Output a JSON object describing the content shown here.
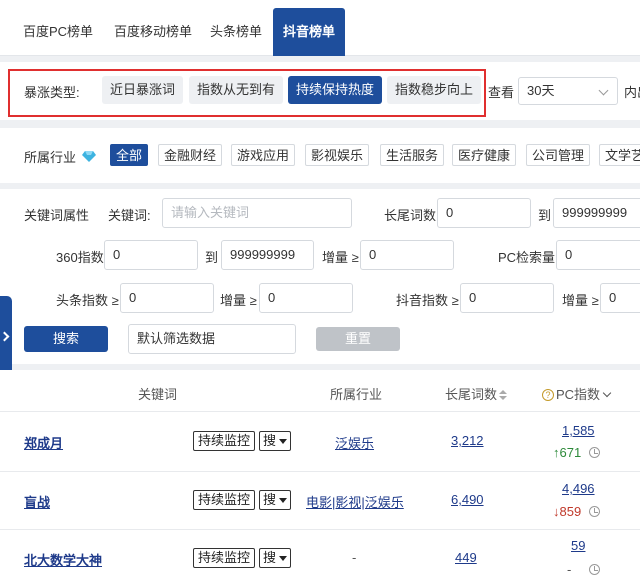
{
  "tabs": [
    "百度PC榜单",
    "百度移动榜单",
    "头条榜单",
    "抖音榜单"
  ],
  "surge": {
    "label": "暴涨类型:",
    "options": [
      "近日暴涨词",
      "指数从无到有",
      "持续保持热度",
      "指数稳步向上"
    ],
    "view_label": "查看",
    "range_value": "30天",
    "trailing": "内出"
  },
  "industry": {
    "label": "所属行业",
    "items": [
      "全部",
      "金融财经",
      "游戏应用",
      "影视娱乐",
      "生活服务",
      "医疗健康",
      "公司管理",
      "文学艺"
    ]
  },
  "filters": {
    "attr_label": "关键词属性",
    "keyword_label": "关键词:",
    "keyword_placeholder": "请输入关键词",
    "longtail_label": "长尾词数",
    "longtail_min": "0",
    "to": "到",
    "longtail_max": "999999999",
    "idx360_label": "360指数",
    "idx360_min": "0",
    "idx360_max": "999999999",
    "inc_label": "增量 ≥",
    "idx360_inc": "0",
    "pc_search_label": "PC检索量",
    "pc_search_val": "0",
    "toutiao_label": "头条指数 ≥",
    "toutiao_val": "0",
    "toutiao_inc": "0",
    "douyin_label": "抖音指数 ≥",
    "douyin_val": "0",
    "douyin_inc": "0",
    "search_btn": "搜索",
    "preset_value": "默认筛选数据",
    "reset_btn": "重置"
  },
  "table": {
    "headers": {
      "keyword": "关键词",
      "industry": "所属行业",
      "longtail": "长尾词数",
      "pc_index": "PC指数"
    },
    "monitor_label": "持续监控",
    "sou_label": "搜",
    "rows": [
      {
        "keyword": "郑成月",
        "industry": "泛娱乐",
        "longtail": "3,212",
        "pc": "1,585",
        "delta": "671",
        "trend": "up"
      },
      {
        "keyword": "盲战",
        "industry": "电影|影视|泛娱乐",
        "longtail": "6,490",
        "pc": "4,496",
        "delta": "859",
        "trend": "down"
      },
      {
        "keyword": "北大数学大神",
        "industry": "-",
        "longtail": "449",
        "pc": "59",
        "delta": "-",
        "trend": "none"
      }
    ]
  },
  "colors": {
    "primary": "#1e4e9c",
    "highlight_border": "#e02f2f",
    "up": "#2d8a3a",
    "down": "#c0392b"
  }
}
